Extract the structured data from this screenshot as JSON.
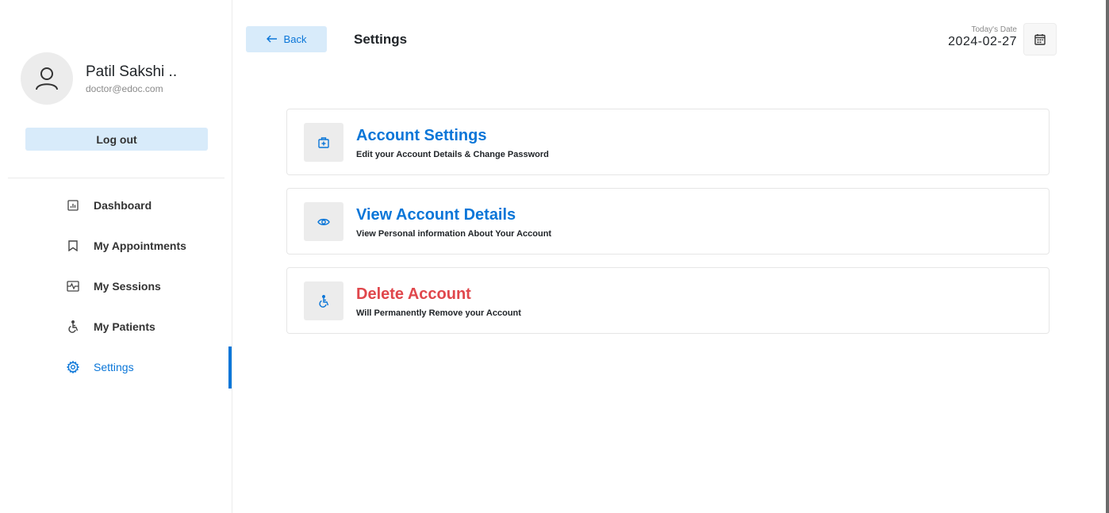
{
  "profile": {
    "name": "Patil Sakshi ..",
    "email": "doctor@edoc.com",
    "logout_label": "Log out"
  },
  "menu": [
    {
      "label": "Dashboard",
      "icon": "dashboard-icon"
    },
    {
      "label": "My Appointments",
      "icon": "bookmark-icon"
    },
    {
      "label": "My Sessions",
      "icon": "sessions-icon"
    },
    {
      "label": "My Patients",
      "icon": "wheelchair-icon"
    },
    {
      "label": "Settings",
      "icon": "gear-icon",
      "active": true
    }
  ],
  "header": {
    "back_label": "Back",
    "title": "Settings",
    "date_label": "Today's Date",
    "date_value": "2024-02-27"
  },
  "cards": [
    {
      "title": "Account Settings",
      "description": "Edit your Account Details & Change Password",
      "icon": "medical-bag-icon"
    },
    {
      "title": "View Account Details",
      "description": "View Personal information About Your Account",
      "icon": "eye-icon"
    },
    {
      "title": "Delete Account",
      "description": "Will Permanently Remove your Account",
      "icon": "wheelchair-icon"
    }
  ],
  "colors": {
    "accent": "#0a76d8",
    "accent_light": "#d8ebfa",
    "danger": "#e0474c"
  }
}
